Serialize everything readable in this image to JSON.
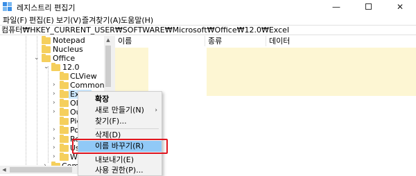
{
  "window": {
    "title": "레지스트리 편집기",
    "minimize_glyph": "—",
    "close_glyph": "✕"
  },
  "menubar": {
    "items": [
      "파일(F)",
      "편집(E)",
      "보기(V)",
      "즐겨찾기(A)",
      "도움말(H)"
    ]
  },
  "address": {
    "path": "컴퓨터₩HKEY_CURRENT_USER₩SOFTWARE₩Microsoft₩Office₩12.0₩Excel"
  },
  "tree": {
    "items": [
      {
        "label": "Notepad"
      },
      {
        "label": "Nucleus"
      },
      {
        "label": "Office"
      },
      {
        "label": "12.0"
      },
      {
        "label": "CLView"
      },
      {
        "label": "Common"
      },
      {
        "label": "Excel"
      },
      {
        "label": "OIS"
      },
      {
        "label": "Out"
      },
      {
        "label": "Pict"
      },
      {
        "label": "Pov"
      },
      {
        "label": "Ref"
      },
      {
        "label": "Us"
      },
      {
        "label": "Wo"
      },
      {
        "label": "Comm"
      }
    ],
    "expand_glyph": "›",
    "collapse_glyph": "⌄"
  },
  "columns": {
    "name": "이름",
    "type": "종류",
    "data": "데이터"
  },
  "context_menu": {
    "items": [
      {
        "label": "확장",
        "bold": true
      },
      {
        "label": "새로 만들기(N)",
        "submenu_glyph": "›"
      },
      {
        "label": "찾기(F)..."
      },
      {
        "label": "삭제(D)"
      },
      {
        "label": "이름 바꾸기(R)"
      },
      {
        "label": "내보내기(E)"
      },
      {
        "label": "사용 권한(P)..."
      }
    ]
  },
  "colors": {
    "highlight_bg": "#fdf6d3",
    "selection": "#cce8ff",
    "menu_hover": "#91c9f7",
    "callout_red": "#e0141e"
  }
}
